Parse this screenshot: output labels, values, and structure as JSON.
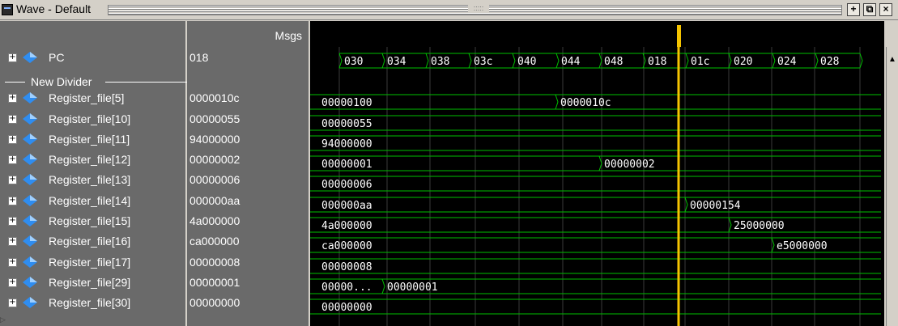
{
  "window": {
    "title": "Wave - Default",
    "buttons": [
      "+",
      "⧉",
      "×"
    ]
  },
  "header": {
    "msgs_label": "Msgs"
  },
  "signals": [
    {
      "name": "PC",
      "value": "018"
    },
    {
      "divider": "New Divider"
    },
    {
      "name": "Register_file[5]",
      "value": "0000010c"
    },
    {
      "name": "Register_file[10]",
      "value": "00000055"
    },
    {
      "name": "Register_file[11]",
      "value": "94000000"
    },
    {
      "name": "Register_file[12]",
      "value": "00000002"
    },
    {
      "name": "Register_file[13]",
      "value": "00000006"
    },
    {
      "name": "Register_file[14]",
      "value": "000000aa"
    },
    {
      "name": "Register_file[15]",
      "value": "4a000000"
    },
    {
      "name": "Register_file[16]",
      "value": "ca000000"
    },
    {
      "name": "Register_file[17]",
      "value": "00000008"
    },
    {
      "name": "Register_file[29]",
      "value": "00000001"
    },
    {
      "name": "Register_file[30]",
      "value": "00000000"
    }
  ],
  "waves": {
    "pc_values": [
      "030",
      "034",
      "038",
      "03c",
      "040",
      "044",
      "048",
      "018",
      "01c",
      "020",
      "024",
      "028"
    ],
    "reg5": [
      "00000100",
      "0000010c"
    ],
    "reg10": [
      "00000055"
    ],
    "reg11": [
      "94000000"
    ],
    "reg12": [
      "00000001",
      "00000002"
    ],
    "reg13": [
      "00000006"
    ],
    "reg14": [
      "000000aa",
      "00000154"
    ],
    "reg15": [
      "4a000000",
      "25000000"
    ],
    "reg16": [
      "ca000000",
      "e5000000"
    ],
    "reg17": [
      "00000008"
    ],
    "reg29": [
      "00000...",
      "00000001"
    ],
    "reg30": [
      "00000000"
    ]
  },
  "colors": {
    "wave": "#00c000",
    "cursor": "#f5c400",
    "grid": "#3a3a3a"
  }
}
